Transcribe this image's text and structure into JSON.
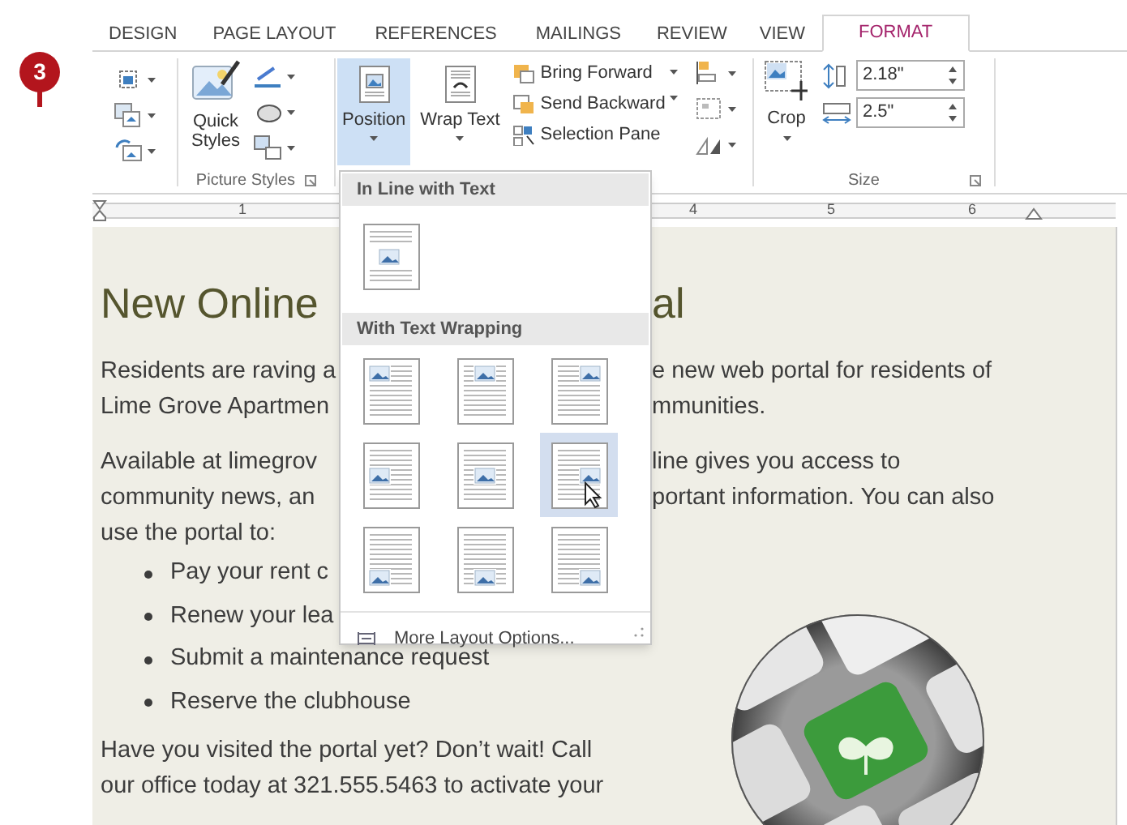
{
  "step_badge": "3",
  "ribbon_tabs": [
    {
      "label": "DESIGN",
      "selected": false
    },
    {
      "label": "PAGE LAYOUT",
      "selected": false
    },
    {
      "label": "REFERENCES",
      "selected": false
    },
    {
      "label": "MAILINGS",
      "selected": false
    },
    {
      "label": "REVIEW",
      "selected": false
    },
    {
      "label": "VIEW",
      "selected": false
    },
    {
      "label": "FORMAT",
      "selected": true
    }
  ],
  "ribbon": {
    "quick_styles": "Quick Styles",
    "picture_styles_label": "Picture Styles",
    "large_buttons": [
      {
        "label": "Position",
        "pressed": true
      },
      {
        "label": "Wrap Text",
        "pressed": false
      }
    ],
    "arrange_buttons": [
      "Bring Forward",
      "Send Backward",
      "Selection Pane"
    ],
    "crop": "Crop",
    "height": "2.18\"",
    "width": "2.5\"",
    "size_label": "Size"
  },
  "ruler": [
    "1",
    "4",
    "5",
    "6"
  ],
  "document": {
    "heading_left": "New Online",
    "heading_right": "al",
    "lines": [
      {
        "kind": "gap"
      },
      {
        "kind": "text",
        "left": "Residents are raving a",
        "right": "e new web portal for residents of"
      },
      {
        "kind": "text",
        "left": "Lime Grove Apartmen",
        "right": "mmunities."
      },
      {
        "kind": "gap"
      },
      {
        "kind": "text",
        "left": "Available at limegrov",
        "right": "line gives you access to"
      },
      {
        "kind": "text",
        "left": "community news, an",
        "right": "portant information. You can also"
      },
      {
        "kind": "text",
        "left": "use the portal to:"
      },
      {
        "kind": "bullet",
        "left": "Pay your rent c"
      },
      {
        "kind": "bullet",
        "left": "Renew your lea"
      },
      {
        "kind": "bullet",
        "left": "Submit a maintenance request"
      },
      {
        "kind": "bullet",
        "left": "Reserve the clubhouse"
      },
      {
        "kind": "text",
        "left": "Have you visited the portal yet? Don’t wait! Call"
      },
      {
        "kind": "text",
        "left": "our office today at 321.555.5463 to activate your"
      }
    ]
  },
  "position_menu": {
    "sections": [
      {
        "heading": "In Line with Text",
        "layouts": [
          {
            "kind": "inline",
            "selected": false
          }
        ]
      },
      {
        "heading": "With Text Wrapping",
        "layouts": [
          {
            "kind": "top-left",
            "selected": false
          },
          {
            "kind": "top-center",
            "selected": false
          },
          {
            "kind": "top-right",
            "selected": false
          },
          {
            "kind": "middle-left",
            "selected": false
          },
          {
            "kind": "middle-center",
            "selected": false
          },
          {
            "kind": "middle-right",
            "selected": true
          },
          {
            "kind": "bottom-left",
            "selected": false
          },
          {
            "kind": "bottom-center",
            "selected": false
          },
          {
            "kind": "bottom-right",
            "selected": false
          }
        ]
      }
    ],
    "more": "More Layout Options..."
  }
}
